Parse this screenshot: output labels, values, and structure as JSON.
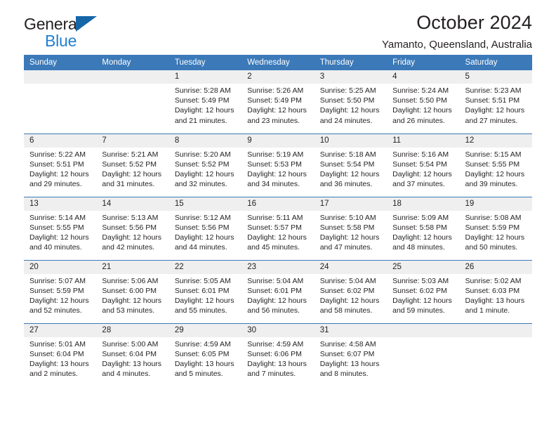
{
  "brand": {
    "line1": "General",
    "line2": "Blue",
    "triangle_color": "#1566a8",
    "blue_text_color": "#1f7fd0"
  },
  "header": {
    "title": "October 2024",
    "subtitle": "Yamanto, Queensland, Australia"
  },
  "colors": {
    "header_blue": "#3b79b8",
    "daynum_band": "#efefef",
    "text": "#231f20"
  },
  "calendar": {
    "weekday_headers": [
      "Sunday",
      "Monday",
      "Tuesday",
      "Wednesday",
      "Thursday",
      "Friday",
      "Saturday"
    ],
    "weeks": [
      [
        {
          "day": "",
          "sunrise": "",
          "sunset": "",
          "daylight": "",
          "empty": true
        },
        {
          "day": "",
          "sunrise": "",
          "sunset": "",
          "daylight": "",
          "empty": true
        },
        {
          "day": "1",
          "sunrise": "Sunrise: 5:28 AM",
          "sunset": "Sunset: 5:49 PM",
          "daylight": "Daylight: 12 hours and 21 minutes."
        },
        {
          "day": "2",
          "sunrise": "Sunrise: 5:26 AM",
          "sunset": "Sunset: 5:49 PM",
          "daylight": "Daylight: 12 hours and 23 minutes."
        },
        {
          "day": "3",
          "sunrise": "Sunrise: 5:25 AM",
          "sunset": "Sunset: 5:50 PM",
          "daylight": "Daylight: 12 hours and 24 minutes."
        },
        {
          "day": "4",
          "sunrise": "Sunrise: 5:24 AM",
          "sunset": "Sunset: 5:50 PM",
          "daylight": "Daylight: 12 hours and 26 minutes."
        },
        {
          "day": "5",
          "sunrise": "Sunrise: 5:23 AM",
          "sunset": "Sunset: 5:51 PM",
          "daylight": "Daylight: 12 hours and 27 minutes."
        }
      ],
      [
        {
          "day": "6",
          "sunrise": "Sunrise: 5:22 AM",
          "sunset": "Sunset: 5:51 PM",
          "daylight": "Daylight: 12 hours and 29 minutes."
        },
        {
          "day": "7",
          "sunrise": "Sunrise: 5:21 AM",
          "sunset": "Sunset: 5:52 PM",
          "daylight": "Daylight: 12 hours and 31 minutes."
        },
        {
          "day": "8",
          "sunrise": "Sunrise: 5:20 AM",
          "sunset": "Sunset: 5:52 PM",
          "daylight": "Daylight: 12 hours and 32 minutes."
        },
        {
          "day": "9",
          "sunrise": "Sunrise: 5:19 AM",
          "sunset": "Sunset: 5:53 PM",
          "daylight": "Daylight: 12 hours and 34 minutes."
        },
        {
          "day": "10",
          "sunrise": "Sunrise: 5:18 AM",
          "sunset": "Sunset: 5:54 PM",
          "daylight": "Daylight: 12 hours and 36 minutes."
        },
        {
          "day": "11",
          "sunrise": "Sunrise: 5:16 AM",
          "sunset": "Sunset: 5:54 PM",
          "daylight": "Daylight: 12 hours and 37 minutes."
        },
        {
          "day": "12",
          "sunrise": "Sunrise: 5:15 AM",
          "sunset": "Sunset: 5:55 PM",
          "daylight": "Daylight: 12 hours and 39 minutes."
        }
      ],
      [
        {
          "day": "13",
          "sunrise": "Sunrise: 5:14 AM",
          "sunset": "Sunset: 5:55 PM",
          "daylight": "Daylight: 12 hours and 40 minutes."
        },
        {
          "day": "14",
          "sunrise": "Sunrise: 5:13 AM",
          "sunset": "Sunset: 5:56 PM",
          "daylight": "Daylight: 12 hours and 42 minutes."
        },
        {
          "day": "15",
          "sunrise": "Sunrise: 5:12 AM",
          "sunset": "Sunset: 5:56 PM",
          "daylight": "Daylight: 12 hours and 44 minutes."
        },
        {
          "day": "16",
          "sunrise": "Sunrise: 5:11 AM",
          "sunset": "Sunset: 5:57 PM",
          "daylight": "Daylight: 12 hours and 45 minutes."
        },
        {
          "day": "17",
          "sunrise": "Sunrise: 5:10 AM",
          "sunset": "Sunset: 5:58 PM",
          "daylight": "Daylight: 12 hours and 47 minutes."
        },
        {
          "day": "18",
          "sunrise": "Sunrise: 5:09 AM",
          "sunset": "Sunset: 5:58 PM",
          "daylight": "Daylight: 12 hours and 48 minutes."
        },
        {
          "day": "19",
          "sunrise": "Sunrise: 5:08 AM",
          "sunset": "Sunset: 5:59 PM",
          "daylight": "Daylight: 12 hours and 50 minutes."
        }
      ],
      [
        {
          "day": "20",
          "sunrise": "Sunrise: 5:07 AM",
          "sunset": "Sunset: 5:59 PM",
          "daylight": "Daylight: 12 hours and 52 minutes."
        },
        {
          "day": "21",
          "sunrise": "Sunrise: 5:06 AM",
          "sunset": "Sunset: 6:00 PM",
          "daylight": "Daylight: 12 hours and 53 minutes."
        },
        {
          "day": "22",
          "sunrise": "Sunrise: 5:05 AM",
          "sunset": "Sunset: 6:01 PM",
          "daylight": "Daylight: 12 hours and 55 minutes."
        },
        {
          "day": "23",
          "sunrise": "Sunrise: 5:04 AM",
          "sunset": "Sunset: 6:01 PM",
          "daylight": "Daylight: 12 hours and 56 minutes."
        },
        {
          "day": "24",
          "sunrise": "Sunrise: 5:04 AM",
          "sunset": "Sunset: 6:02 PM",
          "daylight": "Daylight: 12 hours and 58 minutes."
        },
        {
          "day": "25",
          "sunrise": "Sunrise: 5:03 AM",
          "sunset": "Sunset: 6:02 PM",
          "daylight": "Daylight: 12 hours and 59 minutes."
        },
        {
          "day": "26",
          "sunrise": "Sunrise: 5:02 AM",
          "sunset": "Sunset: 6:03 PM",
          "daylight": "Daylight: 13 hours and 1 minute."
        }
      ],
      [
        {
          "day": "27",
          "sunrise": "Sunrise: 5:01 AM",
          "sunset": "Sunset: 6:04 PM",
          "daylight": "Daylight: 13 hours and 2 minutes."
        },
        {
          "day": "28",
          "sunrise": "Sunrise: 5:00 AM",
          "sunset": "Sunset: 6:04 PM",
          "daylight": "Daylight: 13 hours and 4 minutes."
        },
        {
          "day": "29",
          "sunrise": "Sunrise: 4:59 AM",
          "sunset": "Sunset: 6:05 PM",
          "daylight": "Daylight: 13 hours and 5 minutes."
        },
        {
          "day": "30",
          "sunrise": "Sunrise: 4:59 AM",
          "sunset": "Sunset: 6:06 PM",
          "daylight": "Daylight: 13 hours and 7 minutes."
        },
        {
          "day": "31",
          "sunrise": "Sunrise: 4:58 AM",
          "sunset": "Sunset: 6:07 PM",
          "daylight": "Daylight: 13 hours and 8 minutes."
        },
        {
          "day": "",
          "sunrise": "",
          "sunset": "",
          "daylight": "",
          "empty": true
        },
        {
          "day": "",
          "sunrise": "",
          "sunset": "",
          "daylight": "",
          "empty": true
        }
      ]
    ]
  }
}
